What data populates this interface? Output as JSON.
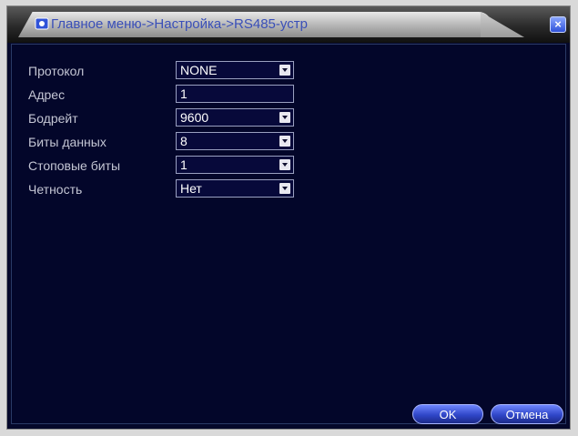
{
  "window": {
    "title": "Главное меню->Настройка->RS485-устр",
    "close_icon": "close-icon"
  },
  "form": {
    "rows": [
      {
        "label": "Протокол",
        "value": "NONE",
        "type": "dropdown"
      },
      {
        "label": "Адрес",
        "value": "1",
        "type": "text"
      },
      {
        "label": "Бодрейт",
        "value": "9600",
        "type": "dropdown"
      },
      {
        "label": "Биты данных",
        "value": "8",
        "type": "dropdown"
      },
      {
        "label": "Стоповые биты",
        "value": "1",
        "type": "dropdown"
      },
      {
        "label": "Четность",
        "value": "Нет",
        "type": "dropdown"
      }
    ]
  },
  "buttons": {
    "ok": "OK",
    "cancel": "Отмена"
  },
  "colors": {
    "background": "#03062a",
    "button": "#2f46c8",
    "title_text": "#3a4fb8"
  }
}
